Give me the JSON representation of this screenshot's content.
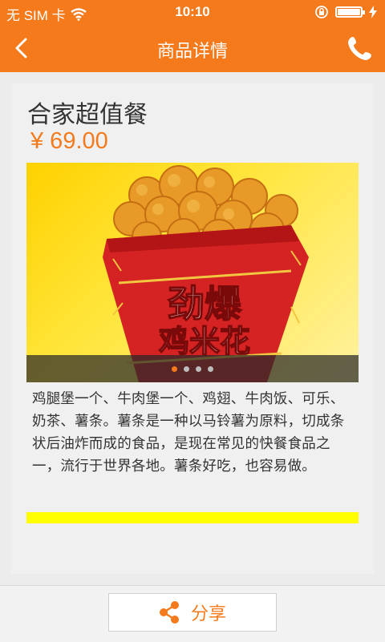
{
  "status_bar": {
    "carrier": "无 SIM 卡",
    "time": "10:10"
  },
  "nav": {
    "title": "商品详情",
    "back_icon": "chevron-left-icon",
    "phone_icon": "phone-icon"
  },
  "product": {
    "name": "合家超值餐",
    "price": "¥ 69.00",
    "image_caption": "劲爆鸡米花",
    "carousel": {
      "count": 4,
      "active_index": 0
    },
    "description": "鸡腿堡一个、牛肉堡一个、鸡翅、牛肉饭、可乐、奶茶、薯条。薯条是一种以马铃薯为原料，切成条状后油炸而成的食品，是现在常见的快餐食品之一，流行于世界各地。薯条好吃，也容易做。"
  },
  "bottom": {
    "share_label": "分享",
    "share_icon": "share-icon"
  },
  "colors": {
    "accent": "#f47a1b",
    "highlight_bar": "#ffff00"
  }
}
